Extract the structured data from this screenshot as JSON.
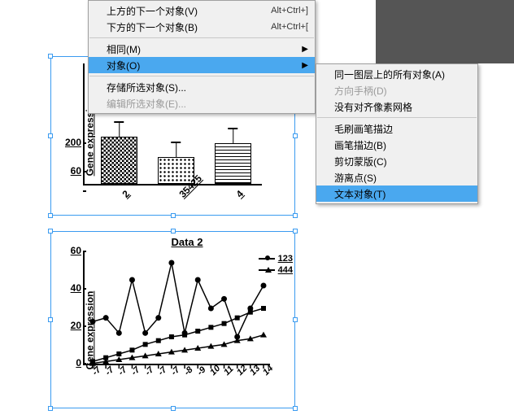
{
  "menu1": {
    "items": [
      {
        "label": "上方的下一个对象(V)",
        "shortcut": "Alt+Ctrl+]",
        "enabled": true,
        "submenu": false
      },
      {
        "label": "下方的下一个对象(B)",
        "shortcut": "Alt+Ctrl+[",
        "enabled": true,
        "submenu": false
      },
      {
        "sep": true
      },
      {
        "label": "相同(M)",
        "enabled": true,
        "submenu": true
      },
      {
        "label": "对象(O)",
        "enabled": true,
        "submenu": true,
        "highlight": true
      },
      {
        "sep": true
      },
      {
        "label": "存储所选对象(S)...",
        "enabled": true,
        "submenu": false
      },
      {
        "label": "编辑所选对象(E)...",
        "enabled": false,
        "submenu": false
      }
    ]
  },
  "menu2": {
    "items": [
      {
        "label": "同一图层上的所有对象(A)",
        "enabled": true
      },
      {
        "label": "方向手柄(D)",
        "enabled": false
      },
      {
        "label": "没有对齐像素网格",
        "enabled": true
      },
      {
        "sep": true
      },
      {
        "label": "毛刷画笔描边",
        "enabled": true
      },
      {
        "label": "画笔描边(B)",
        "enabled": true
      },
      {
        "label": "剪切蒙版(C)",
        "enabled": true
      },
      {
        "label": "游离点(S)",
        "enabled": true
      },
      {
        "label": "文本对象(T)",
        "enabled": true,
        "highlight": true
      }
    ]
  },
  "chart_data": [
    {
      "type": "bar",
      "title": "",
      "ylabel": "Gene expression",
      "ylim": [
        0,
        600
      ],
      "yticks": [
        60,
        200
      ],
      "categories": [
        "2",
        "35425",
        "4"
      ],
      "values": [
        230,
        130,
        200
      ],
      "errors": [
        40,
        30,
        35
      ]
    },
    {
      "type": "line",
      "title": "Data 2",
      "ylabel": "Gene expression",
      "ylim": [
        0,
        60
      ],
      "yticks": [
        0,
        20,
        40,
        60
      ],
      "x": [
        -7,
        -7,
        -7,
        -7,
        -7,
        -7,
        -7,
        -8,
        -9,
        10,
        11,
        12,
        13,
        14
      ],
      "series": [
        {
          "name": "123",
          "marker": "circle",
          "values": [
            23,
            25,
            17,
            45,
            17,
            25,
            54,
            17,
            45,
            30,
            35,
            15,
            30,
            42
          ]
        },
        {
          "name": "444",
          "marker": "square",
          "values": [
            2,
            4,
            6,
            8,
            11,
            13,
            15,
            16,
            18,
            20,
            22,
            25,
            28,
            30
          ]
        },
        {
          "name": "",
          "marker": "triangle",
          "values": [
            1,
            2,
            3,
            4,
            5,
            6,
            7,
            8,
            9,
            10,
            11,
            13,
            14,
            16
          ]
        }
      ]
    }
  ]
}
